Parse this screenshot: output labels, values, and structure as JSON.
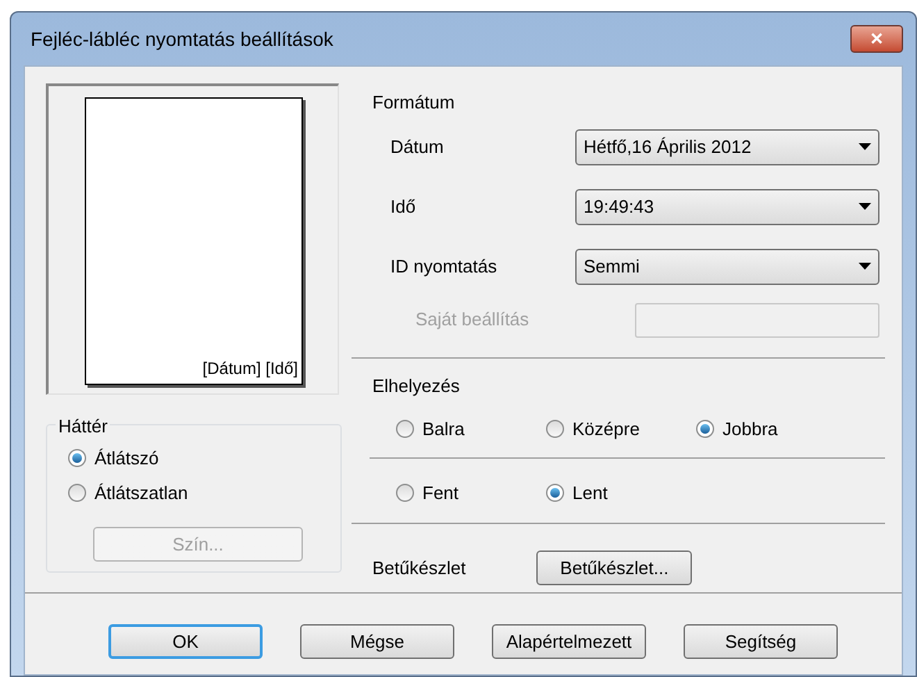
{
  "window": {
    "title": "Fejléc-lábléc nyomtatás beállítások",
    "close": "✕"
  },
  "preview": {
    "text": "[Dátum] [Idő]"
  },
  "background": {
    "label": "Háttér",
    "options": [
      {
        "label": "Átlátszó",
        "selected": true
      },
      {
        "label": "Átlátszatlan",
        "selected": false
      }
    ],
    "color_button": {
      "label": "Szín...",
      "disabled": true
    }
  },
  "format": {
    "label": "Formátum",
    "fields": [
      {
        "label": "Dátum",
        "value": "Hétfő,16 Április 2012"
      },
      {
        "label": "Idő",
        "value": "19:49:43"
      },
      {
        "label": "ID nyomtatás",
        "value": "Semmi"
      }
    ],
    "custom": {
      "label": "Saját beállítás",
      "disabled": true
    }
  },
  "placement": {
    "label": "Elhelyezés",
    "horizontal": [
      {
        "label": "Balra",
        "selected": false
      },
      {
        "label": "Középre",
        "selected": false
      },
      {
        "label": "Jobbra",
        "selected": true
      }
    ],
    "vertical": [
      {
        "label": "Fent",
        "selected": false
      },
      {
        "label": "Lent",
        "selected": true
      }
    ]
  },
  "font": {
    "label": "Betűkészlet",
    "button": "Betűkészlet..."
  },
  "buttons": [
    {
      "label": "OK",
      "default": true
    },
    {
      "label": "Mégse",
      "default": false
    },
    {
      "label": "Alapértelmezett",
      "default": false
    },
    {
      "label": "Segítség",
      "default": false
    }
  ]
}
